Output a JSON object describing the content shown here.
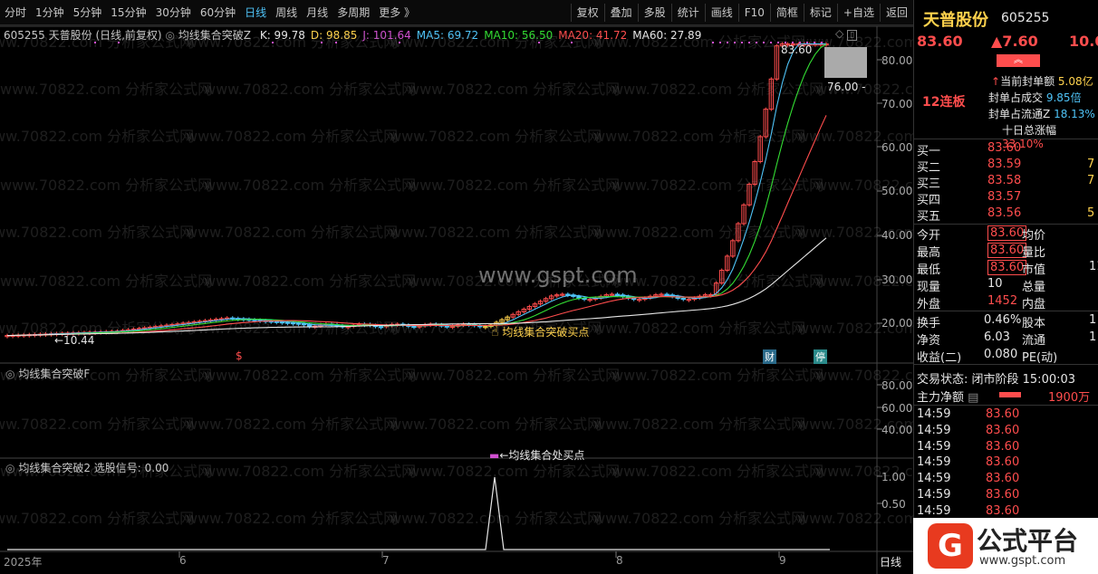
{
  "toolbar": {
    "periods": [
      "分时",
      "1分钟",
      "5分钟",
      "15分钟",
      "30分钟",
      "60分钟",
      "日线",
      "周线",
      "月线",
      "多周期",
      "更多 》"
    ],
    "active_period": "日线",
    "tools": [
      "复权",
      "叠加",
      "多股",
      "统计",
      "画线",
      "F10",
      "简框",
      "标记",
      "+自选",
      "返回"
    ]
  },
  "main_panel": {
    "header_prefix": "605255 天普股份 (日线,前复权)",
    "indicator_name": "均线集合突破Z",
    "values": [
      {
        "label": "K: 99.78",
        "color": "#e6e6e6"
      },
      {
        "label": "D: 98.85",
        "color": "#ffd24d"
      },
      {
        "label": "J: 101.64",
        "color": "#d050d0"
      },
      {
        "label": "MA5: 69.72",
        "color": "#4fc3f7"
      },
      {
        "label": "MA10: 56.50",
        "color": "#33dd33"
      },
      {
        "label": "MA20: 41.72",
        "color": "#ff4d4d"
      },
      {
        "label": "MA60: 27.89",
        "color": "#e6e6e6"
      }
    ],
    "y_ticks": [
      "80.00",
      "70.00",
      "60.00",
      "50.00",
      "40.00",
      "30.00",
      "20.00"
    ],
    "high_label": "83.60",
    "low_label": "76.00 -",
    "min_label": "←10.44",
    "buy_label": "均线集合突破买点",
    "marker_s": "$",
    "marker_cai": "财",
    "marker_ting": "停",
    "watermark_center": "www.gspt.com",
    "watermark_row": "www.70822.com 分析家公式网"
  },
  "panel2": {
    "title": "均线集合突破F",
    "y_ticks": [
      "80.00",
      "60.00",
      "40.00"
    ],
    "signal_label": "←均线集合处买点"
  },
  "panel3": {
    "title": "均线集合突破2 选股信号: 0.00",
    "y_ticks": [
      "1.00",
      "0.50"
    ]
  },
  "x_axis": {
    "labels": [
      "2025年",
      "6",
      "7",
      "8",
      "9"
    ],
    "period_tag": "日线"
  },
  "quote": {
    "name": "天普股份",
    "code": "605255",
    "price": "83.60",
    "change": "▲7.60",
    "pct": "10.0",
    "limit_streak": "12连板",
    "seal_amount_label": "当前封单额",
    "seal_amount": "5.08亿",
    "seal_vs_turnover_label": "封单占成交",
    "seal_vs_turnover": "9.85倍",
    "seal_vs_float_label": "封单占流通Z",
    "seal_vs_float": "18.13%",
    "ten_day_label": "十日总涨幅",
    "ten_day": "33.10%",
    "bids": [
      {
        "label": "买一",
        "price": "83.60",
        "vol": ""
      },
      {
        "label": "买二",
        "price": "83.59",
        "vol": "7"
      },
      {
        "label": "买三",
        "price": "83.58",
        "vol": "7"
      },
      {
        "label": "买四",
        "price": "83.57",
        "vol": ""
      },
      {
        "label": "买五",
        "price": "83.56",
        "vol": "5"
      }
    ],
    "stats": [
      {
        "l1": "今开",
        "v1": "83.60",
        "l2": "均价",
        "v2": ""
      },
      {
        "l1": "最高",
        "v1": "83.60",
        "l2": "量比",
        "v2": ""
      },
      {
        "l1": "最低",
        "v1": "83.60",
        "l2": "市值",
        "v2": "11"
      },
      {
        "l1": "现量",
        "v1": "10",
        "l2": "总量",
        "v2": ""
      },
      {
        "l1": "外盘",
        "v1": "1452",
        "l2": "内盘",
        "v2": ""
      }
    ],
    "stats2": [
      {
        "l1": "换手",
        "v1": "0.46%",
        "l2": "股本",
        "v2": "1"
      },
      {
        "l1": "净资",
        "v1": "6.03",
        "l2": "流通",
        "v2": "1"
      },
      {
        "l1": "收益(二)",
        "v1": "0.080",
        "l2": "PE(动)",
        "v2": ""
      }
    ],
    "trade_status": "交易状态: 闭市阶段 15:00:03",
    "main_flow_label": "主力净额",
    "main_flow": "1900万",
    "ticks": [
      {
        "t": "14:59",
        "p": "83.60"
      },
      {
        "t": "14:59",
        "p": "83.60"
      },
      {
        "t": "14:59",
        "p": "83.60"
      },
      {
        "t": "14:59",
        "p": "83.60"
      },
      {
        "t": "14:59",
        "p": "83.60"
      },
      {
        "t": "14:59",
        "p": "83.60"
      },
      {
        "t": "14:59",
        "p": "83.60"
      },
      {
        "t": "14:59",
        "p": "83.60"
      }
    ],
    "logo_text": "公式平台",
    "logo_url": "www.gspt.com"
  }
}
